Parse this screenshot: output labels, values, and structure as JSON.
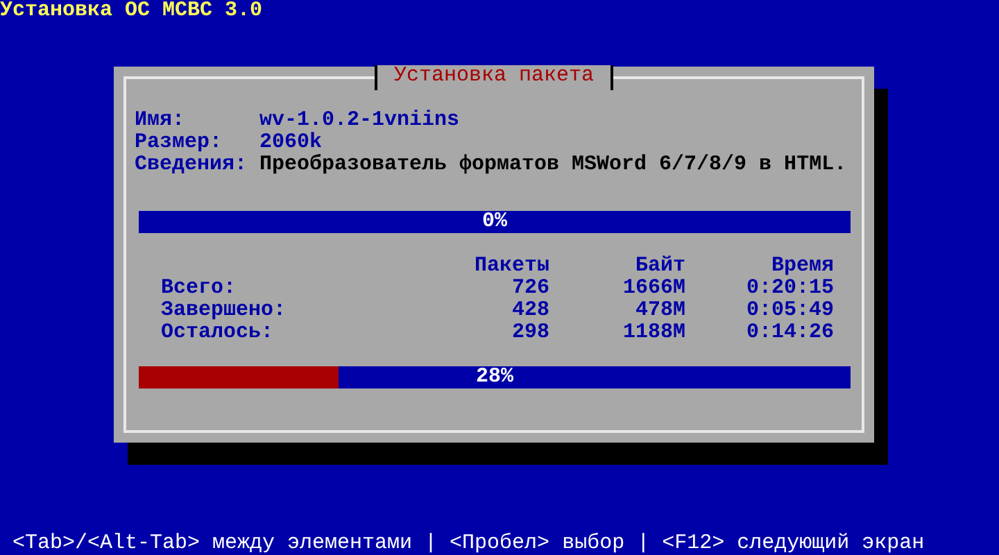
{
  "screen_title": "Установка ОС МСВС 3.0",
  "dialog": {
    "title": "Установка пакета",
    "fields": [
      {
        "label": "Имя:",
        "value": "wv-1.0.2-1vniins"
      },
      {
        "label": "Размер:",
        "value": "2060k"
      },
      {
        "label": "Сведения:",
        "value": "Преобразователь форматов MSWord 6/7/8/9 в HTML."
      }
    ],
    "package_progress": {
      "level": 0,
      "reading": "0%"
    },
    "stats": {
      "columns": [
        "Пакеты",
        "Байт",
        "Время"
      ],
      "rows": [
        {
          "label": "Всего:",
          "cells": [
            "726",
            "1666M",
            "0:20:15"
          ]
        },
        {
          "label": "Завершено:",
          "cells": [
            "428",
            "478M",
            "0:05:49"
          ]
        },
        {
          "label": "Осталось:",
          "cells": [
            "298",
            "1188M",
            "0:14:26"
          ]
        }
      ]
    },
    "total_progress": {
      "level": 0.28,
      "reading": "28%"
    }
  },
  "help_bar": "<Tab>/<Alt-Tab> между элементами | <Пробел> выбор | <F12> следующий экран"
}
